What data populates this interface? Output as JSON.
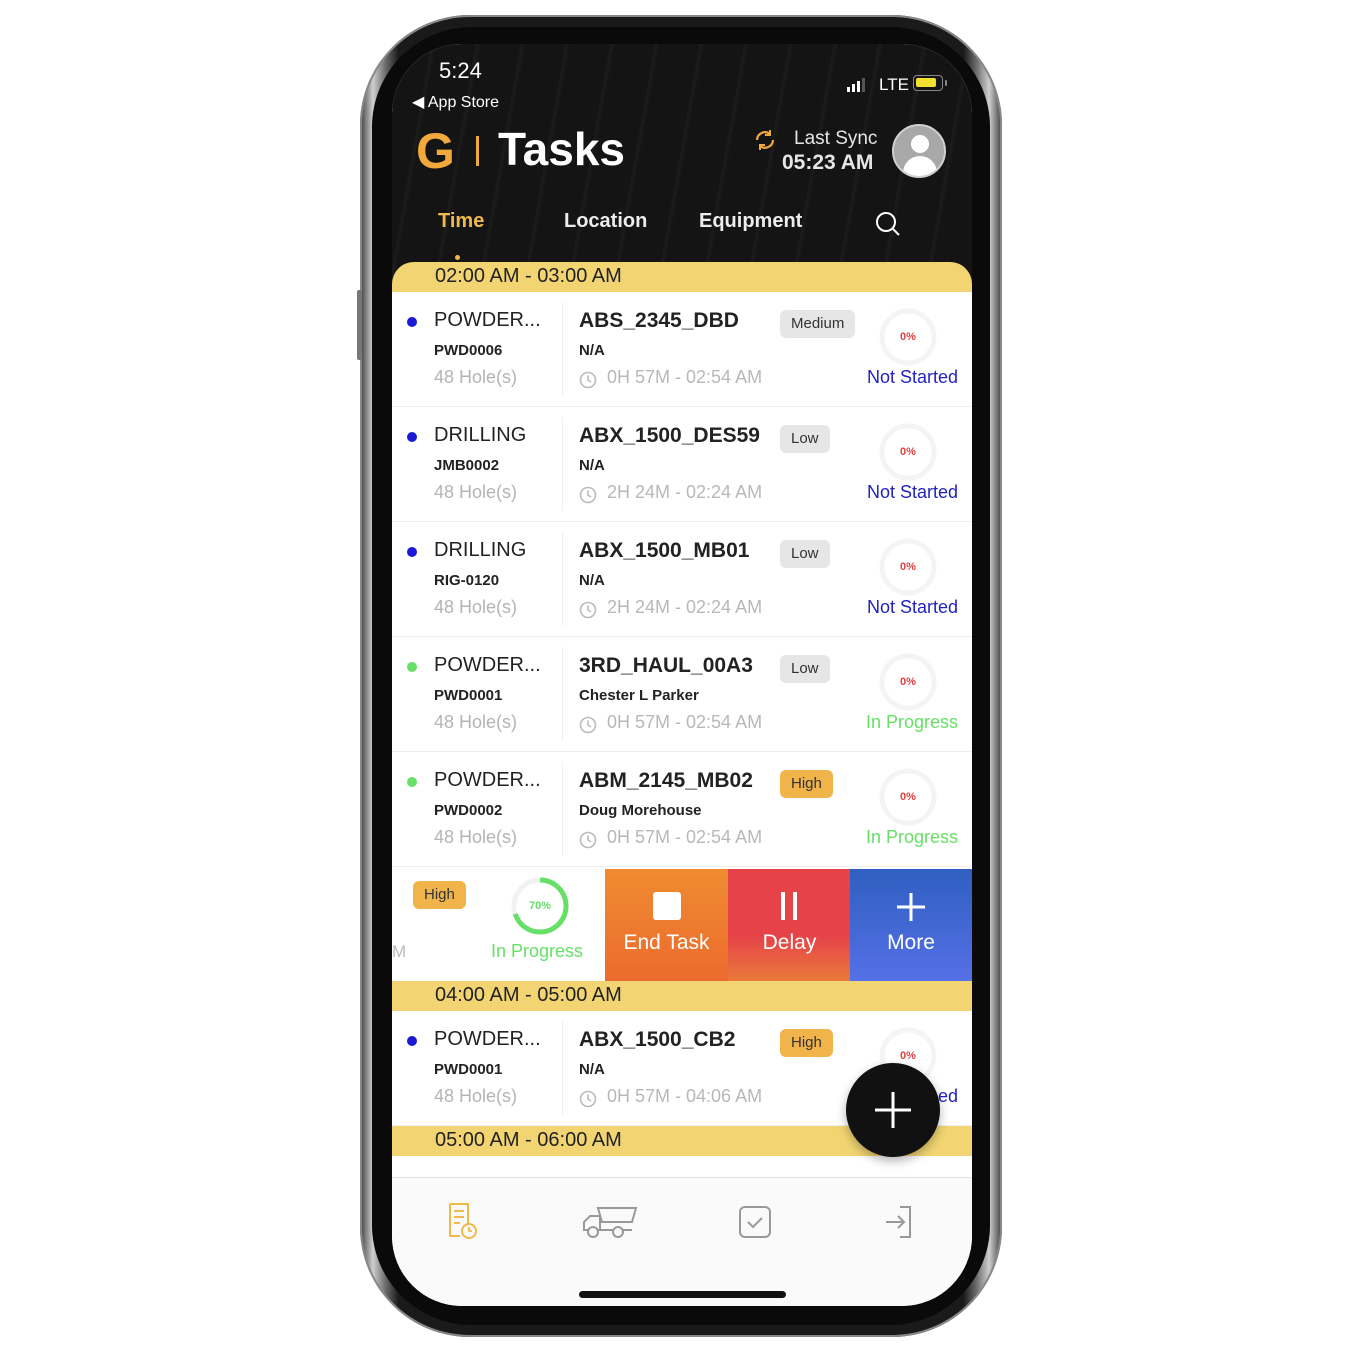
{
  "status_bar": {
    "time": "5:24",
    "back_app": "App Store",
    "network": "LTE",
    "battery_level": 0.7
  },
  "header": {
    "logo_letter": "G",
    "title": "Tasks",
    "sync_label": "Last Sync",
    "sync_time": "05:23 AM"
  },
  "tabs": [
    {
      "label": "Time",
      "active": true
    },
    {
      "label": "Location",
      "active": false
    },
    {
      "label": "Equipment",
      "active": false
    }
  ],
  "sections": [
    {
      "label": "02:00 AM - 03:00 AM",
      "tasks": [
        {
          "type": "POWDER...",
          "code": "PWD0006",
          "holes": "48 Hole(s)",
          "name": "ABS_2345_DBD",
          "person": "N/A",
          "duration": "0H 57M - 02:54 AM",
          "priority": "Medium",
          "progress": "0%",
          "status": "Not Started",
          "dot_color": "#1a1ad6"
        },
        {
          "type": "DRILLING",
          "code": "JMB0002",
          "holes": "48 Hole(s)",
          "name": "ABX_1500_DES59",
          "person": "N/A",
          "duration": "2H 24M - 02:24 AM",
          "priority": "Low",
          "progress": "0%",
          "status": "Not Started",
          "dot_color": "#1a1ad6"
        },
        {
          "type": "DRILLING",
          "code": "RIG-0120",
          "holes": "48 Hole(s)",
          "name": "ABX_1500_MB01",
          "person": "N/A",
          "duration": "2H 24M - 02:24 AM",
          "priority": "Low",
          "progress": "0%",
          "status": "Not Started",
          "dot_color": "#1a1ad6"
        },
        {
          "type": "POWDER...",
          "code": "PWD0001",
          "holes": "48 Hole(s)",
          "name": "3RD_HAUL_00A3",
          "person": "Chester L Parker",
          "duration": "0H 57M - 02:54 AM",
          "priority": "Low",
          "progress": "0%",
          "status": "In Progress",
          "dot_color": "#66e066"
        },
        {
          "type": "POWDER...",
          "code": "PWD0002",
          "holes": "48 Hole(s)",
          "name": "ABM_2145_MB02",
          "person": "Doug Morehouse",
          "duration": "0H 57M - 02:54 AM",
          "priority": "High",
          "progress": "0%",
          "status": "In Progress",
          "dot_color": "#66e066"
        }
      ],
      "swiped_task": {
        "partial_text": "M",
        "priority": "High",
        "progress": "70%",
        "progress_value": 0.7,
        "status": "In Progress",
        "actions": [
          {
            "label": "End Task",
            "icon": "stop-icon"
          },
          {
            "label": "Delay",
            "icon": "pause-icon"
          },
          {
            "label": "More",
            "icon": "plus-icon"
          }
        ]
      }
    },
    {
      "label": "04:00 AM - 05:00 AM",
      "tasks": [
        {
          "type": "POWDER...",
          "code": "PWD0001",
          "holes": "48 Hole(s)",
          "name": "ABX_1500_CB2",
          "person": "N/A",
          "duration": "0H 57M - 04:06 AM",
          "priority": "High",
          "progress": "0%",
          "status": "Not Started",
          "status_visible": "ed",
          "dot_color": "#1a1ad6"
        }
      ]
    },
    {
      "label": "05:00 AM - 06:00 AM",
      "tasks": []
    }
  ],
  "bottom_nav": [
    {
      "icon": "task-schedule-icon",
      "active": true
    },
    {
      "icon": "dump-truck-icon",
      "active": false
    },
    {
      "icon": "checkbox-icon",
      "active": false
    },
    {
      "icon": "logout-icon",
      "active": false
    }
  ],
  "colors": {
    "accent": "#f0b94a",
    "section_bg": "#f2d572",
    "not_started": "#2222c0",
    "in_progress": "#66e066",
    "end_task": "#ec7a2e",
    "delay": "#e64349",
    "more": "#4466d6"
  }
}
